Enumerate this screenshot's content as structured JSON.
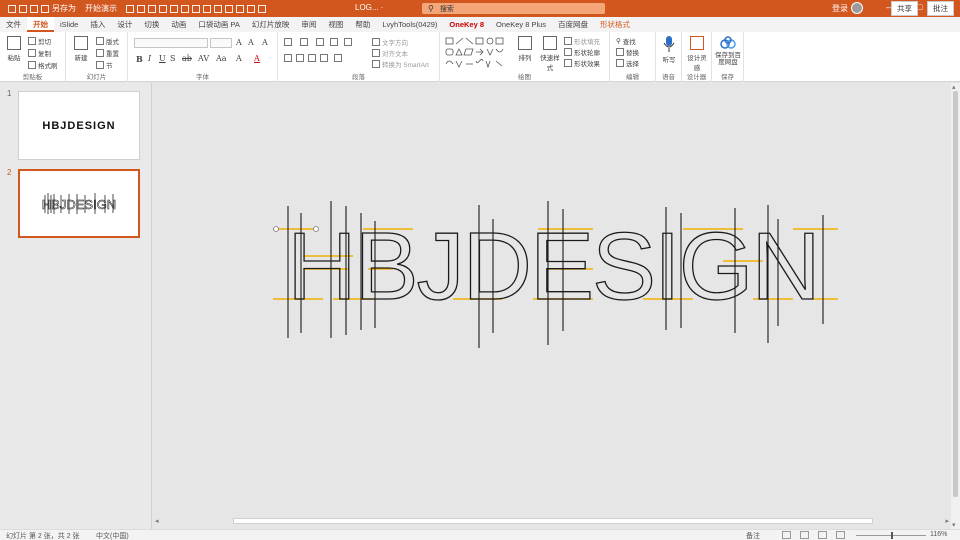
{
  "titlebar": {
    "qat_labels": [
      "另存为",
      "开始演示"
    ],
    "doc_title": "LOG... ·",
    "search_placeholder": "搜索",
    "user": "登录",
    "win": [
      "—",
      "□",
      "✕"
    ]
  },
  "tabs": [
    {
      "label": "文件"
    },
    {
      "label": "开始",
      "active": true
    },
    {
      "label": "iSlide"
    },
    {
      "label": "插入"
    },
    {
      "label": "设计"
    },
    {
      "label": "切换"
    },
    {
      "label": "动画"
    },
    {
      "label": "口袋动画 PA"
    },
    {
      "label": "幻灯片放映"
    },
    {
      "label": "审阅"
    },
    {
      "label": "视图"
    },
    {
      "label": "帮助"
    },
    {
      "label": "LvyhTools(0429)"
    },
    {
      "label": "OneKey 8",
      "hot": true
    },
    {
      "label": "OneKey 8 Plus"
    },
    {
      "label": "百度网盘"
    },
    {
      "label": "形状格式",
      "ctx": true
    }
  ],
  "share_label": "共享",
  "comment_label": "批注",
  "ribbon": {
    "groups": [
      "剪贴板",
      "幻灯片",
      "字体",
      "段落",
      "绘图",
      "编辑",
      "语音",
      "设计器",
      "保存"
    ],
    "clipboard": {
      "paste": "粘贴",
      "cut": "剪切",
      "copy": "复制",
      "format_painter": "格式刷"
    },
    "slides": {
      "new": "新建",
      "layout": "版式",
      "reset": "重置",
      "section": "节"
    },
    "paragraph": {
      "text_dir": "文字方向",
      "align_text": "对齐文本",
      "smartart": "转换为 SmartArt"
    },
    "drawing": {
      "arrange": "排列",
      "quick_styles": "快速样式",
      "fill": "形状填充",
      "outline": "形状轮廓",
      "effects": "形状效果"
    },
    "editing": {
      "find": "查找",
      "replace": "替换",
      "select": "选择"
    },
    "voice": {
      "dictate": "听写"
    },
    "designer": {
      "ideas": "设计灵感"
    },
    "save": {
      "save_to": "保存到百度网盘"
    }
  },
  "slides": [
    {
      "num": "1",
      "text": "HBJDESIGN"
    },
    {
      "num": "2",
      "text": "HBJDESIGN",
      "active": true
    }
  ],
  "slide_main": {
    "text": "HBJDESIGN",
    "accent": "#f0b000",
    "stroke": "#1a1a1a"
  },
  "status": {
    "slide_info": "幻灯片 第 2 张，共 2 张",
    "lang": "中文(中国)",
    "notes": "备注",
    "zoom": "116%"
  }
}
